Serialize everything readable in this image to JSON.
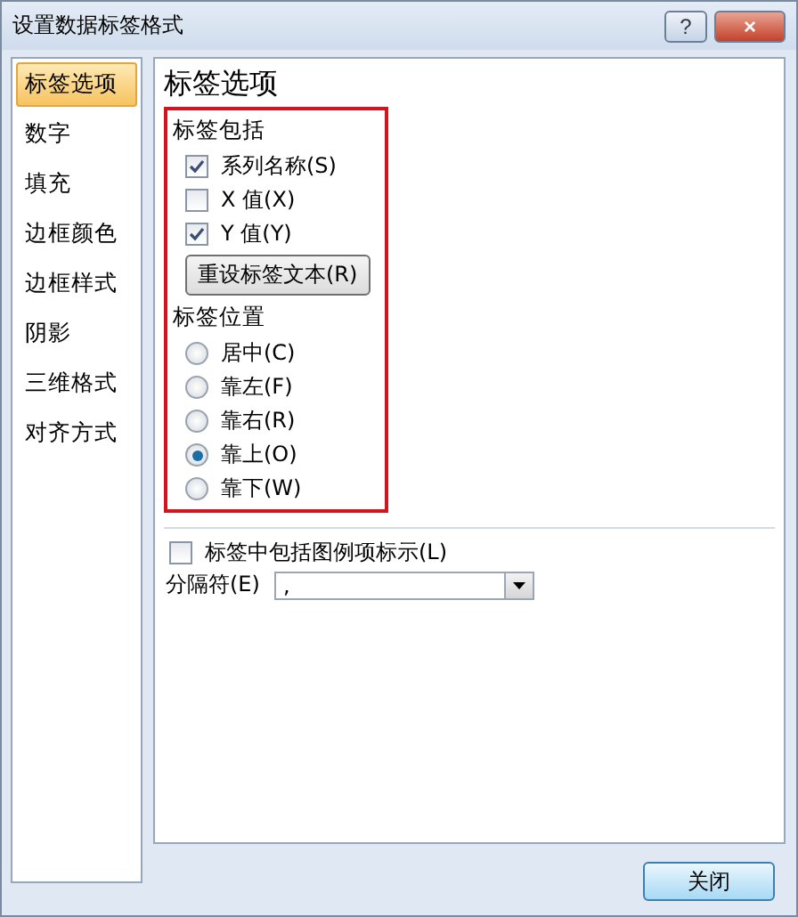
{
  "window": {
    "title": "设置数据标签格式",
    "help": "?",
    "close": "×"
  },
  "sidebar": {
    "items": [
      {
        "label": "标签选项",
        "selected": true
      },
      {
        "label": "数字",
        "selected": false
      },
      {
        "label": "填充",
        "selected": false
      },
      {
        "label": "边框颜色",
        "selected": false
      },
      {
        "label": "边框样式",
        "selected": false
      },
      {
        "label": "阴影",
        "selected": false
      },
      {
        "label": "三维格式",
        "selected": false
      },
      {
        "label": "对齐方式",
        "selected": false
      }
    ]
  },
  "panel": {
    "title": "标签选项",
    "contains": {
      "heading": "标签包括",
      "options": [
        {
          "label": "系列名称(S)",
          "checked": true
        },
        {
          "label": "X 值(X)",
          "checked": false
        },
        {
          "label": "Y 值(Y)",
          "checked": true
        }
      ],
      "reset_button": "重设标签文本(R)"
    },
    "position": {
      "heading": "标签位置",
      "options": [
        {
          "label": "居中(C)",
          "selected": false
        },
        {
          "label": "靠左(F)",
          "selected": false
        },
        {
          "label": "靠右(R)",
          "selected": false
        },
        {
          "label": "靠上(O)",
          "selected": true
        },
        {
          "label": "靠下(W)",
          "selected": false
        }
      ]
    },
    "legend_key": {
      "label": "标签中包括图例项标示(L)",
      "checked": false
    },
    "separator": {
      "label": "分隔符(E)",
      "value": ","
    }
  },
  "buttons": {
    "close": "关闭"
  }
}
